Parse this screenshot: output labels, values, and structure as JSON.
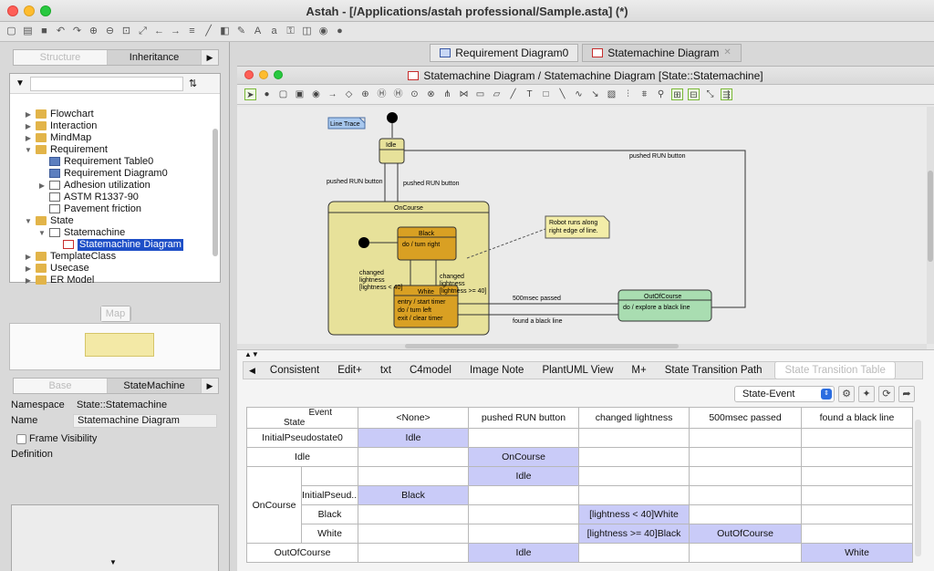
{
  "window": {
    "title": "Astah - [/Applications/astah professional/Sample.asta] (*)"
  },
  "left": {
    "tree_tabs": [
      "Structure",
      "Inheritance"
    ],
    "tree_tabs_arrow": "▶",
    "tree": [
      {
        "label": "Flowchart",
        "icon": "folder-icon",
        "level": 0,
        "twisty": "▶"
      },
      {
        "label": "Interaction",
        "icon": "folder-icon",
        "level": 0,
        "twisty": "▶"
      },
      {
        "label": "MindMap",
        "icon": "folder-icon",
        "level": 0,
        "twisty": "▶"
      },
      {
        "label": "Requirement",
        "icon": "folder-icon",
        "level": 0,
        "twisty": "▼"
      },
      {
        "label": "Requirement Table0",
        "icon": "requirement-table-icon",
        "level": 1,
        "twisty": ""
      },
      {
        "label": "Requirement Diagram0",
        "icon": "requirement-diagram-icon",
        "level": 1,
        "twisty": ""
      },
      {
        "label": "Adhesion utilization",
        "icon": "requirement-icon",
        "level": 1,
        "twisty": "▶"
      },
      {
        "label": "ASTM R1337-90",
        "icon": "requirement-icon",
        "level": 1,
        "twisty": ""
      },
      {
        "label": "Pavement friction",
        "icon": "requirement-icon",
        "level": 1,
        "twisty": ""
      },
      {
        "label": "State",
        "icon": "folder-icon",
        "level": 0,
        "twisty": "▼"
      },
      {
        "label": "Statemachine",
        "icon": "state-icon",
        "level": 1,
        "twisty": "▼"
      },
      {
        "label": "Statemachine Diagram",
        "icon": "statemachine-diagram-icon",
        "level": 2,
        "twisty": "",
        "selected": true
      },
      {
        "label": "TemplateClass",
        "icon": "folder-icon",
        "level": 0,
        "twisty": "▶"
      },
      {
        "label": "Usecase",
        "icon": "folder-icon",
        "level": 0,
        "twisty": "▶"
      },
      {
        "label": "ER Model",
        "icon": "folder-icon",
        "level": 0,
        "twisty": "▶"
      }
    ],
    "map_label": "Map",
    "prop_tabs": [
      "Base",
      "StateMachine"
    ],
    "props": {
      "namespace_label": "Namespace",
      "namespace_value": "State::Statemachine",
      "name_label": "Name",
      "name_value": "Statemachine Diagram",
      "frame_visibility_label": "Frame Visibility",
      "definition_label": "Definition"
    }
  },
  "doc_tabs": [
    "Requirement Diagram0",
    "Statemachine Diagram"
  ],
  "inner_title": "Statemachine Diagram / Statemachine Diagram [State::Statemachine]",
  "diagram": {
    "line_trace": "Line Trace",
    "idle": "Idle",
    "oncourse": "OnCourse",
    "black": {
      "name": "Black",
      "action": "do / turn right"
    },
    "white": {
      "name": "White",
      "actions": [
        "entry / start timer",
        "do / turn left",
        "exit / clear timer"
      ]
    },
    "outofcourse": {
      "name": "OutOfCourse",
      "action": "do / explore a black line"
    },
    "note": [
      "Robot runs along",
      "right edge of line."
    ],
    "transitions": {
      "run_left": "pushed RUN button",
      "run_right": "pushed RUN button",
      "run_top": "pushed RUN button",
      "to_white": [
        "changed",
        "lightness",
        "[lightness < 40]"
      ],
      "to_black": [
        "changed",
        "lightness",
        "[lightness >= 40]"
      ],
      "timeout": "500msec passed",
      "found": "found a black line"
    }
  },
  "bottom": {
    "tabs": [
      "Consistent",
      "Edit+",
      "txt",
      "C4model",
      "Image Note",
      "PlantUML View",
      "M+",
      "State Transition Path",
      "State Transition Table"
    ],
    "tab_arrow": "◀",
    "selector": "State-Event",
    "header_event": "Event",
    "header_state": "State",
    "columns": [
      "<None>",
      "pushed RUN button",
      "changed lightness",
      "500msec passed",
      "found a black line"
    ],
    "rows": {
      "initial": {
        "label": "InitialPseudostate0",
        "cells": [
          "Idle",
          "",
          "",
          "",
          ""
        ]
      },
      "idle": {
        "label": "Idle",
        "cells": [
          "",
          "OnCourse",
          "",
          "",
          ""
        ]
      },
      "oncourse": {
        "label": "OnCourse",
        "cells": [
          "",
          "Idle",
          "",
          "",
          ""
        ]
      },
      "oc_initial": {
        "label": "InitialPseud...",
        "cells": [
          "Black",
          "",
          "",
          "",
          ""
        ]
      },
      "oc_black": {
        "label": "Black",
        "cells": [
          "",
          "",
          "[lightness < 40]White",
          "",
          ""
        ]
      },
      "oc_white": {
        "label": "White",
        "cells": [
          "",
          "",
          "[lightness >= 40]Black",
          "OutOfCourse",
          ""
        ]
      },
      "outofcourse": {
        "label": "OutOfCourse",
        "cells": [
          "",
          "Idle",
          "",
          "",
          "White"
        ]
      }
    }
  }
}
